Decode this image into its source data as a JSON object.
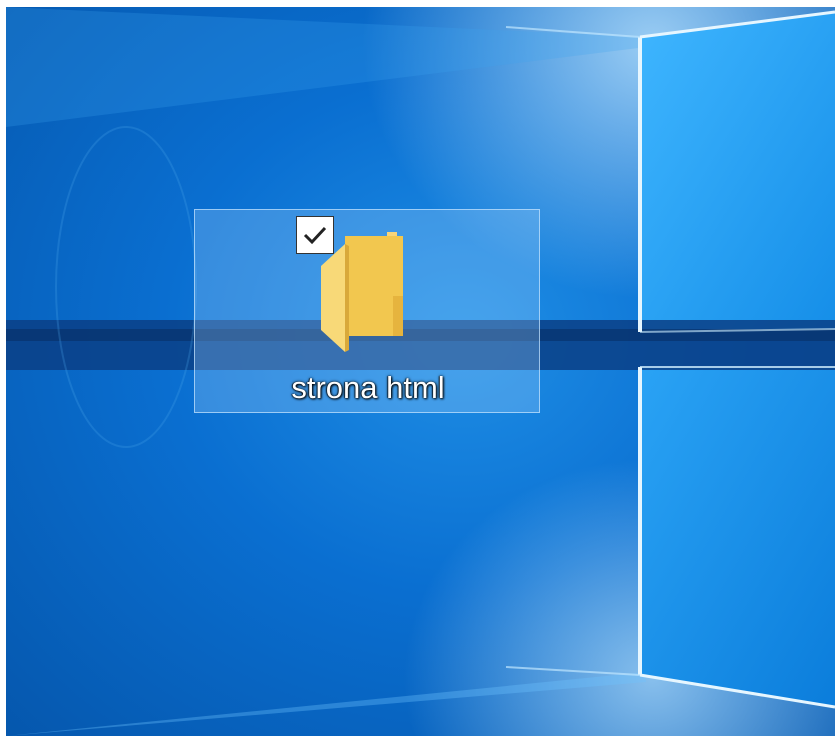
{
  "desktop": {
    "folder": {
      "label": "strona html",
      "selected": true,
      "icon": "folder-icon"
    },
    "checkbox": {
      "checked": true,
      "icon": "checkmark-icon"
    },
    "colors": {
      "wallpaper_blue": "#0a6fd1",
      "wallpaper_light": "#2ea8ff",
      "selection_fill": "#add6ff",
      "folder_yellow": "#f5c95a",
      "label_text": "#ffffff"
    }
  }
}
